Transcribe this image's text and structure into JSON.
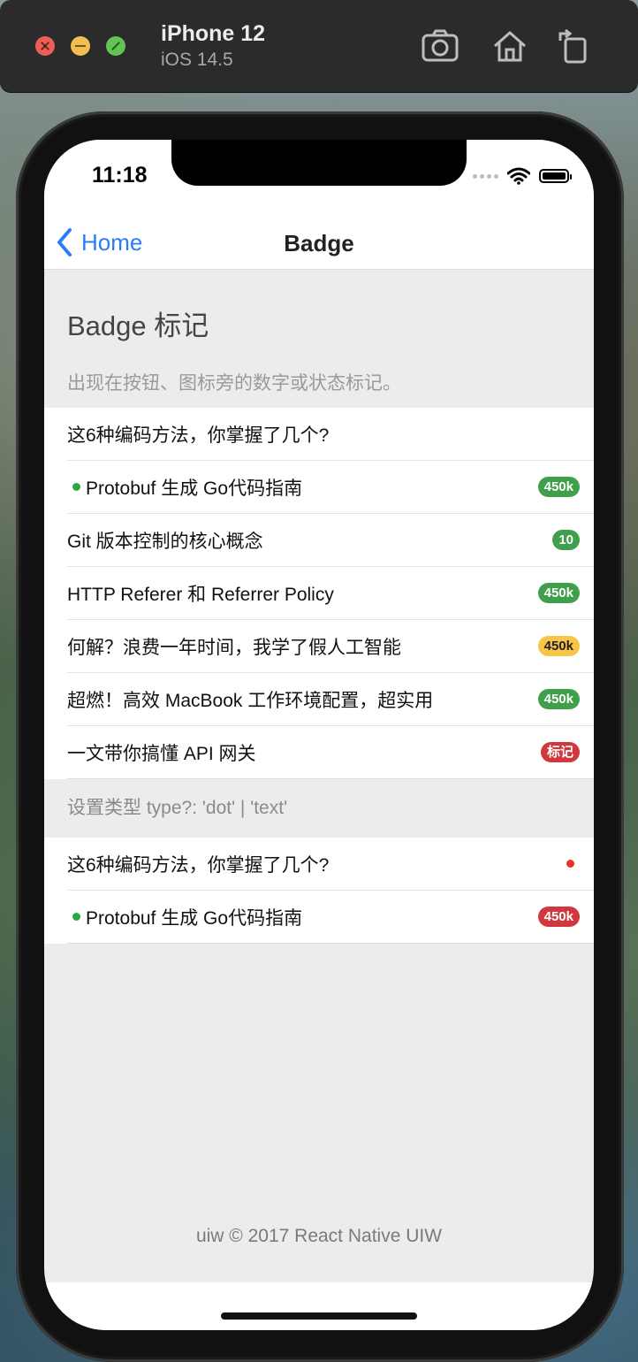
{
  "simulator": {
    "device_name": "iPhone 12",
    "os_version": "iOS 14.5"
  },
  "statusbar": {
    "time": "11:18"
  },
  "navbar": {
    "back_label": "Home",
    "title": "Badge"
  },
  "page": {
    "heading": "Badge 标记",
    "description": "出现在按钮、图标旁的数字或状态标记。"
  },
  "list1": [
    {
      "text": "这6种编码方法，你掌握了几个?",
      "dot_prefix": false,
      "badge": "",
      "badge_type": "none",
      "badge_color": ""
    },
    {
      "text": "Protobuf 生成 Go代码指南",
      "dot_prefix": true,
      "badge": "450k",
      "badge_type": "text",
      "badge_color": "#3f9f4a"
    },
    {
      "text": "Git 版本控制的核心概念",
      "dot_prefix": false,
      "badge": "10",
      "badge_type": "text",
      "badge_color": "#3f9f4a"
    },
    {
      "text": "HTTP Referer 和 Referrer Policy",
      "dot_prefix": false,
      "badge": "450k",
      "badge_type": "text",
      "badge_color": "#3f9f4a"
    },
    {
      "text": "何解？浪费一年时间，我学了假人工智能",
      "dot_prefix": false,
      "badge": "450k",
      "badge_type": "text",
      "badge_color": "#f7c547",
      "badge_text_color": "#222"
    },
    {
      "text": "超燃！高效 MacBook 工作环境配置，超实用",
      "dot_prefix": false,
      "badge": "450k",
      "badge_type": "text",
      "badge_color": "#3f9f4a"
    },
    {
      "text": "一文带你搞懂 API 网关",
      "dot_prefix": false,
      "badge": "标记",
      "badge_type": "text",
      "badge_color": "#d0383e"
    }
  ],
  "section2": {
    "label": "设置类型 type?: 'dot' | 'text'"
  },
  "list2": [
    {
      "text": "这6种编码方法，你掌握了几个?",
      "dot_prefix": false,
      "badge": "",
      "badge_type": "dot",
      "badge_color": "#e8322a"
    },
    {
      "text": "Protobuf 生成 Go代码指南",
      "dot_prefix": true,
      "badge": "450k",
      "badge_type": "text",
      "badge_color": "#d0383e"
    }
  ],
  "footer": {
    "text": "uiw © 2017 React Native UIW"
  },
  "colors": {
    "accent": "#2c7cf6",
    "green": "#3f9f4a",
    "dot_prefix": "#28a745"
  }
}
